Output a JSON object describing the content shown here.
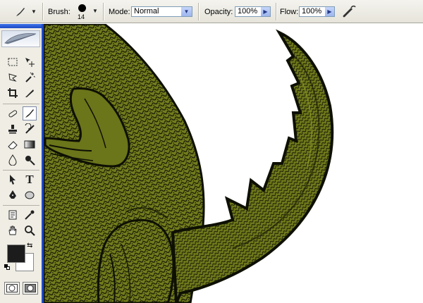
{
  "options_bar": {
    "brush_label": "Brush:",
    "brush_size": "14",
    "mode_label": "Mode:",
    "mode_value": "Normal",
    "opacity_label": "Opacity:",
    "opacity_value": "100%",
    "flow_label": "Flow:",
    "flow_value": "100%"
  },
  "toolbox": {
    "tools": [
      "marquee-tool",
      "move-tool",
      "lasso-tool",
      "magic-wand-tool",
      "crop-tool",
      "slice-tool",
      "healing-brush-tool",
      "brush-tool",
      "stamp-tool",
      "history-brush-tool",
      "eraser-tool",
      "gradient-tool",
      "blur-tool",
      "dodge-tool",
      "path-selection-tool",
      "type-tool",
      "pen-tool",
      "shape-tool",
      "notes-tool",
      "eyedropper-tool",
      "hand-tool",
      "zoom-tool"
    ],
    "active_tool": "brush-tool",
    "foreground_color": "#1c1c1c",
    "background_color": "#ffffff"
  },
  "canvas": {
    "illustration": "green textured dinosaur (body, arm, leg and spiked tail)",
    "colors": {
      "skin": "#6f7a1c",
      "outline": "#0e1004"
    }
  }
}
